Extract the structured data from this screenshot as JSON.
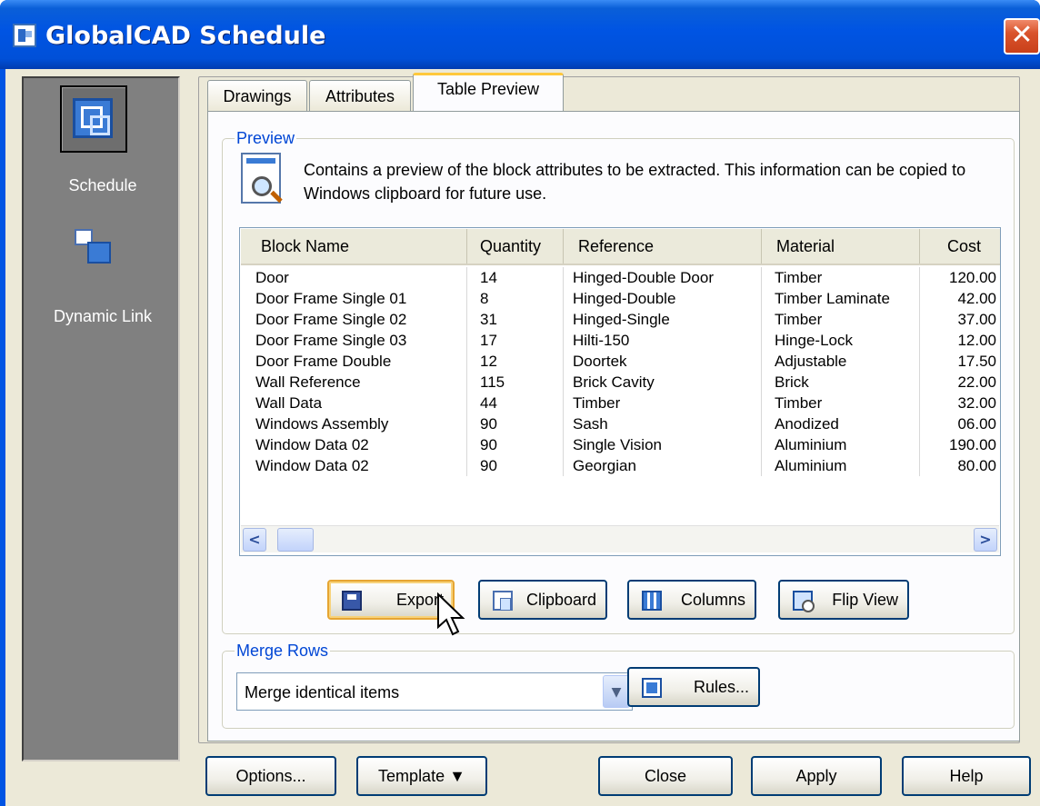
{
  "window": {
    "title": "GlobalCAD Schedule",
    "close_glyph": "✕"
  },
  "sidebar": {
    "items": [
      {
        "label": "Schedule",
        "icon": "schedule-icon",
        "selected": true
      },
      {
        "label": "Dynamic Link",
        "icon": "dynamic-link-icon",
        "selected": false
      }
    ]
  },
  "tabs": [
    {
      "label": "Drawings",
      "active": false
    },
    {
      "label": "Attributes",
      "active": false
    },
    {
      "label": "Table Preview",
      "active": true
    }
  ],
  "preview": {
    "group_title": "Preview",
    "description": "Contains a preview of the block attributes to be extracted. This information can be copied to Windows clipboard for future use.",
    "columns": [
      "Block Name",
      "Quantity",
      "Reference",
      "Material",
      "Cost"
    ],
    "rows": [
      [
        "Door",
        "14",
        "Hinged-Double Door",
        "Timber",
        "120.00"
      ],
      [
        "Door Frame Single 01",
        "8",
        "Hinged-Double",
        "Timber Laminate",
        "42.00"
      ],
      [
        "Door Frame Single 02",
        "31",
        "Hinged-Single",
        "Timber",
        "37.00"
      ],
      [
        "Door Frame Single 03",
        "17",
        "Hilti-150",
        "Hinge-Lock",
        "12.00"
      ],
      [
        "Door Frame Double",
        "12",
        "Doortek",
        "Adjustable",
        "17.50"
      ],
      [
        "Wall Reference",
        "115",
        "Brick Cavity",
        "Brick",
        "22.00"
      ],
      [
        "Wall Data",
        "44",
        "Timber",
        "Timber",
        "32.00"
      ],
      [
        "Windows Assembly",
        "90",
        "Sash",
        "Anodized",
        "06.00"
      ],
      [
        "Window Data 02",
        "90",
        "Single Vision",
        "Aluminium",
        "190.00"
      ],
      [
        "Window Data 02",
        "90",
        "Georgian",
        "Aluminium",
        "80.00"
      ]
    ],
    "scroll_left_glyph": "<",
    "scroll_right_glyph": ">",
    "buttons": {
      "export": "Export",
      "clipboard": "Clipboard",
      "columns": "Columns",
      "flip_view": "Flip View"
    }
  },
  "merge_rows": {
    "group_title": "Merge Rows",
    "selected": "Merge identical items",
    "dropdown_glyph": "▼",
    "rules_button": "Rules..."
  },
  "footer": {
    "options": "Options...",
    "template": "Template",
    "template_arrow": "▼",
    "close": "Close",
    "apply": "Apply",
    "help": "Help"
  },
  "colors": {
    "titlebar": "#0054e3",
    "dialog_bg": "#ece9d8",
    "sidebar_bg": "#808080",
    "group_title": "#0046d5",
    "active_tab_highlight": "#ffc83c"
  }
}
